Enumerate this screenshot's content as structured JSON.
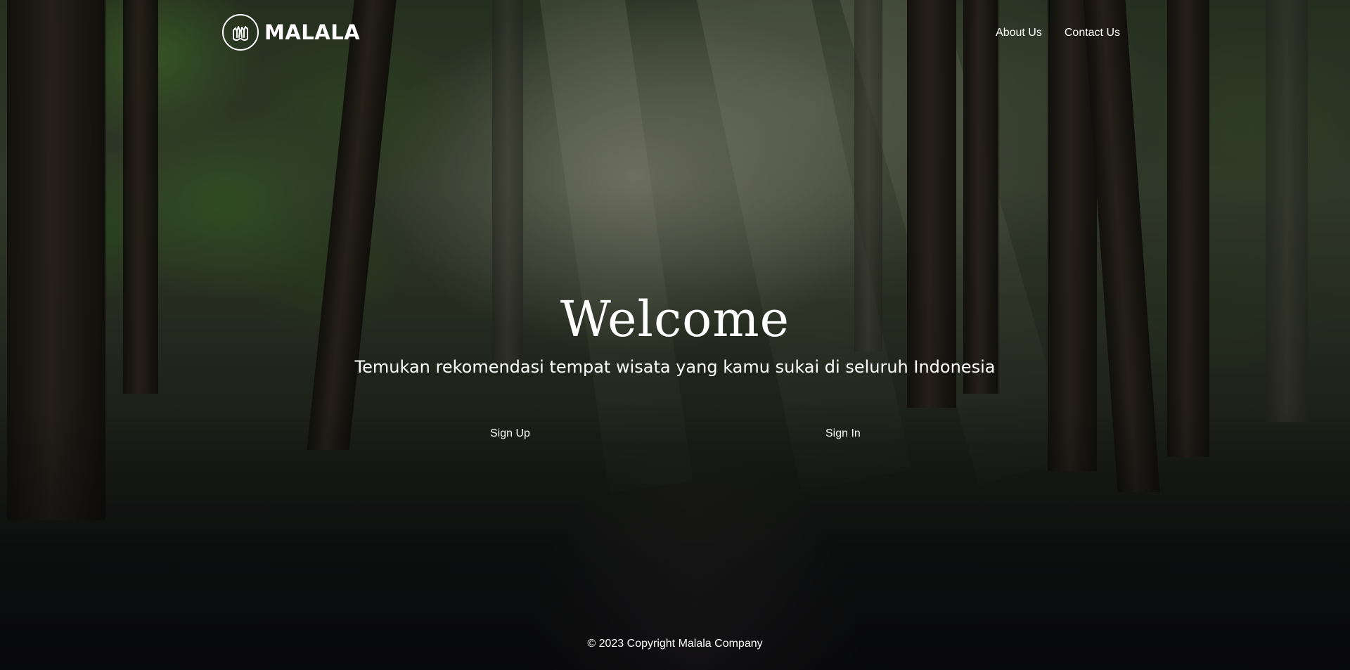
{
  "brand": {
    "name": "MALALA",
    "logo_icon": "hands-circle-icon"
  },
  "nav": {
    "items": [
      {
        "label": "About Us"
      },
      {
        "label": "Contact Us"
      }
    ]
  },
  "hero": {
    "title": "Welcome",
    "subtitle": "Temukan rekomendasi tempat wisata yang kamu sukai di seluruh Indonesia",
    "background": "forest-path-photo"
  },
  "actions": {
    "sign_up": "Sign Up",
    "sign_in": "Sign In"
  },
  "footer": {
    "copyright": "© 2023 Copyright Malala Company"
  },
  "colors": {
    "text": "#ffffff",
    "overlay": "#000000"
  }
}
